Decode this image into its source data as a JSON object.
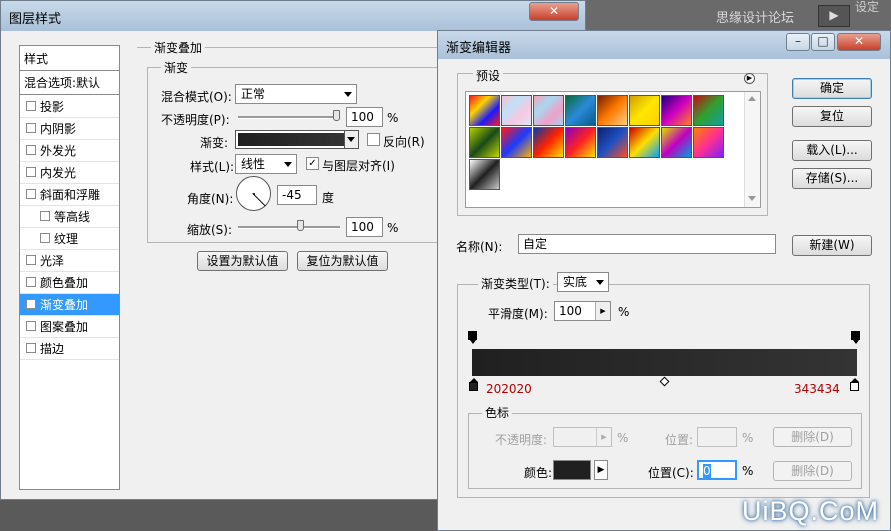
{
  "background": {
    "site_name": "思缘设计论坛",
    "corner_text": "设定",
    "watermark": "UiBQ.CoM"
  },
  "layer_style": {
    "title": "图层样式",
    "close_label": "✕",
    "styles_header": "样式",
    "blend_default": "混合选项:默认",
    "items": [
      {
        "label": "投影",
        "checked": false
      },
      {
        "label": "内阴影",
        "checked": false
      },
      {
        "label": "外发光",
        "checked": false
      },
      {
        "label": "内发光",
        "checked": false
      },
      {
        "label": "斜面和浮雕",
        "checked": false
      },
      {
        "label": "等高线",
        "checked": false
      },
      {
        "label": "纹理",
        "checked": false
      },
      {
        "label": "光泽",
        "checked": false
      },
      {
        "label": "颜色叠加",
        "checked": false
      },
      {
        "label": "渐变叠加",
        "checked": true
      },
      {
        "label": "图案叠加",
        "checked": false
      },
      {
        "label": "描边",
        "checked": false
      }
    ],
    "section_title": "渐变叠加",
    "subsection_title": "渐变",
    "blend_mode_label": "混合模式(O):",
    "blend_mode_value": "正常",
    "opacity_label": "不透明度(P):",
    "opacity_value": "100",
    "opacity_unit": "%",
    "gradient_label": "渐变:",
    "reverse_label": "反向(R)",
    "style_label": "样式(L):",
    "style_value": "线性",
    "align_label": "与图层对齐(I)",
    "align_checked": true,
    "angle_label": "角度(N):",
    "angle_value": "-45",
    "angle_unit": "度",
    "scale_label": "缩放(S):",
    "scale_value": "100",
    "scale_unit": "%",
    "set_default_button": "设置为默认值",
    "reset_default_button": "复位为默认值"
  },
  "gradient_editor": {
    "title": "渐变编辑器",
    "presets_label": "预设",
    "ok_button": "确定",
    "reset_button": "复位",
    "load_button": "载入(L)...",
    "save_button": "存储(S)...",
    "name_label": "名称(N):",
    "name_value": "自定",
    "new_button": "新建(W)",
    "gradient_type_label": "渐变类型(T):",
    "gradient_type_value": "实底",
    "smoothness_label": "平滑度(M):",
    "smoothness_value": "100",
    "smoothness_unit": "%",
    "left_stop_hex": "202020",
    "right_stop_hex": "343434",
    "stops_title": "色标",
    "stop_opacity_label": "不透明度:",
    "stop_opacity_unit": "%",
    "opacity_location_label": "位置:",
    "opacity_location_unit": "%",
    "delete_label_1": "删除(D)",
    "color_label": "颜色:",
    "color_location_label": "位置(C):",
    "color_location_value": "0",
    "color_location_unit": "%",
    "delete_label_2": "删除(D)",
    "stop_colors": {
      "left": "#202020",
      "right": "#343434"
    }
  }
}
